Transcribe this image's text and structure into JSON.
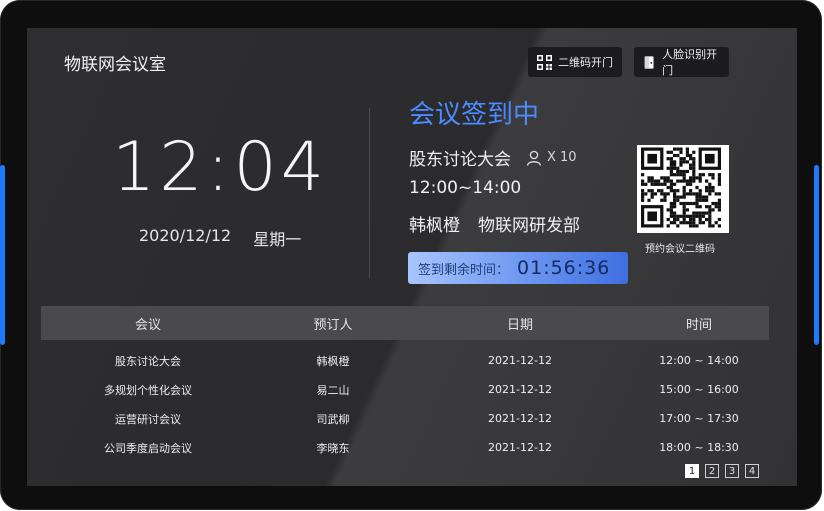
{
  "header": {
    "room_title": "物联网会议室",
    "qr_door_label": "二维码开门",
    "face_door_label": "人脸识别开门"
  },
  "clock": {
    "time": "12:04",
    "date": "2020/12/12",
    "weekday": "星期一"
  },
  "meeting": {
    "status": "会议签到中",
    "name": "股东讨论大会",
    "attendee_count": "X 10",
    "time_range": "12:00~14:00",
    "host": "韩枫橙",
    "department": "物联网研发部",
    "countdown_label": "签到剩余时间：",
    "countdown_value": "01:56:36",
    "qr_caption": "预约会议二维码"
  },
  "table": {
    "headers": [
      "会议",
      "预订人",
      "日期",
      "时间"
    ],
    "rows": [
      [
        "股东讨论大会",
        "韩枫橙",
        "2021-12-12",
        "12:00 ~ 14:00"
      ],
      [
        "多规划个性化会议",
        "易二山",
        "2021-12-12",
        "15:00 ~ 16:00"
      ],
      [
        "运营研讨会议",
        "司武柳",
        "2021-12-12",
        "17:00 ~ 17:30"
      ],
      [
        "公司季度启动会议",
        "李晓东",
        "2021-12-12",
        "18:00 ~ 18:30"
      ]
    ]
  },
  "pagination": {
    "pages": [
      "1",
      "2",
      "3",
      "4"
    ],
    "current": "1"
  },
  "colors": {
    "accent": "#4a8cff",
    "side_light": "#1e7bff",
    "countdown_start": "#a9c5ff",
    "countdown_end": "#3f6fe0"
  },
  "icons": {
    "qr_door": "qr-code-icon",
    "face_door": "door-icon",
    "attendees": "person-icon"
  }
}
